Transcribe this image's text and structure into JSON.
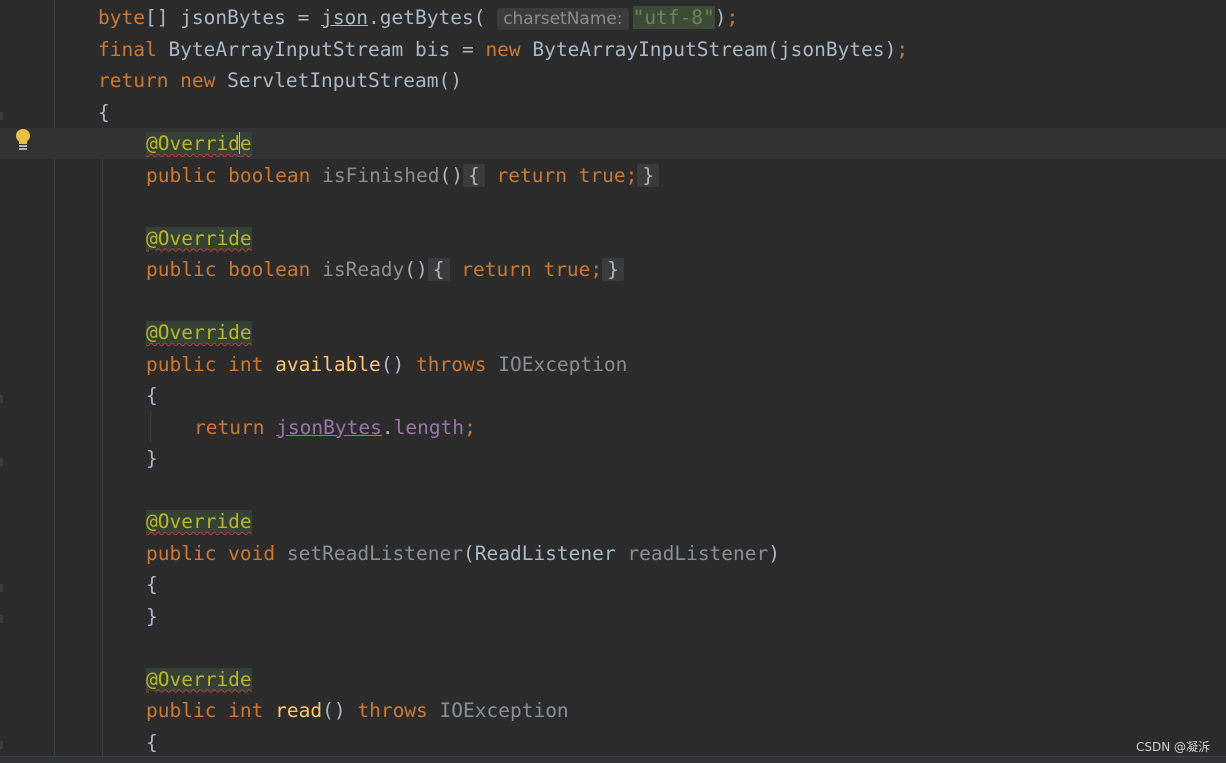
{
  "editor": {
    "lines": [
      {
        "indent": 0,
        "tokens": [
          {
            "t": "byte",
            "c": "kw"
          },
          {
            "t": "[] jsonBytes = "
          },
          {
            "t": "json",
            "c": "ul"
          },
          {
            "t": ".getBytes( "
          },
          {
            "t": "charsetName:",
            "c": "hint"
          },
          {
            "t": "\"utf-8\"",
            "c": "str"
          },
          {
            "t": ")"
          },
          {
            "t": ";",
            "c": "kw"
          }
        ]
      },
      {
        "indent": 0,
        "tokens": [
          {
            "t": "final ",
            "c": "kw"
          },
          {
            "t": "ByteArrayInputStream bis = "
          },
          {
            "t": "new ",
            "c": "kw"
          },
          {
            "t": "ByteArrayInputStream(jsonBytes)"
          },
          {
            "t": ";",
            "c": "kw"
          }
        ]
      },
      {
        "indent": 0,
        "tokens": [
          {
            "t": "return new ",
            "c": "kw"
          },
          {
            "t": "ServletInputStream()"
          }
        ]
      },
      {
        "indent": 0,
        "tokens": [
          {
            "t": "{"
          }
        ]
      },
      {
        "indent": 1,
        "current": true,
        "tokens": [
          {
            "t": "@Overrid",
            "c": "ann"
          },
          {
            "t": "",
            "c": "caret"
          },
          {
            "t": "e",
            "c": "ann"
          }
        ]
      },
      {
        "indent": 1,
        "tokens": [
          {
            "t": "public boolean ",
            "c": "kw"
          },
          {
            "t": "isFinished",
            "c": "mut"
          },
          {
            "t": "()"
          },
          {
            "t": "{",
            "c": "fold-box"
          },
          {
            "t": " return true",
            "c": "kw"
          },
          {
            "t": ";",
            "c": "kw"
          },
          {
            "t": "}",
            "c": "fold-box"
          }
        ]
      },
      {
        "indent": 1,
        "tokens": []
      },
      {
        "indent": 1,
        "tokens": [
          {
            "t": "@Override",
            "c": "ann"
          }
        ]
      },
      {
        "indent": 1,
        "tokens": [
          {
            "t": "public boolean ",
            "c": "kw"
          },
          {
            "t": "isReady",
            "c": "mut"
          },
          {
            "t": "()"
          },
          {
            "t": "{",
            "c": "fold-box"
          },
          {
            "t": " return true",
            "c": "kw"
          },
          {
            "t": ";",
            "c": "kw"
          },
          {
            "t": "}",
            "c": "fold-box"
          }
        ]
      },
      {
        "indent": 1,
        "tokens": []
      },
      {
        "indent": 1,
        "tokens": [
          {
            "t": "@Override",
            "c": "ann"
          }
        ]
      },
      {
        "indent": 1,
        "tokens": [
          {
            "t": "public int ",
            "c": "kw"
          },
          {
            "t": "available",
            "c": "fn"
          },
          {
            "t": "() "
          },
          {
            "t": "throws ",
            "c": "kw"
          },
          {
            "t": "IOException",
            "c": "mut"
          }
        ]
      },
      {
        "indent": 1,
        "tokens": [
          {
            "t": "{"
          }
        ]
      },
      {
        "indent": 2,
        "tokens": [
          {
            "t": "return ",
            "c": "kw"
          },
          {
            "t": "jsonBytes",
            "c": "field"
          },
          {
            "t": "."
          },
          {
            "t": "length",
            "c": "field-plain"
          },
          {
            "t": ";",
            "c": "kw"
          }
        ]
      },
      {
        "indent": 1,
        "tokens": [
          {
            "t": "}"
          }
        ]
      },
      {
        "indent": 1,
        "tokens": []
      },
      {
        "indent": 1,
        "tokens": [
          {
            "t": "@Override",
            "c": "ann"
          }
        ]
      },
      {
        "indent": 1,
        "tokens": [
          {
            "t": "public void ",
            "c": "kw"
          },
          {
            "t": "setReadListener",
            "c": "mut"
          },
          {
            "t": "(ReadListener "
          },
          {
            "t": "readListener",
            "c": "mut"
          },
          {
            "t": ")"
          }
        ]
      },
      {
        "indent": 1,
        "tokens": [
          {
            "t": "{"
          }
        ]
      },
      {
        "indent": 1,
        "tokens": [
          {
            "t": "}"
          }
        ]
      },
      {
        "indent": 1,
        "tokens": []
      },
      {
        "indent": 1,
        "tokens": [
          {
            "t": "@Override",
            "c": "ann"
          }
        ]
      },
      {
        "indent": 1,
        "tokens": [
          {
            "t": "public int ",
            "c": "kw"
          },
          {
            "t": "read",
            "c": "fn"
          },
          {
            "t": "() "
          },
          {
            "t": "throws ",
            "c": "kw"
          },
          {
            "t": "IOException",
            "c": "mut"
          }
        ]
      },
      {
        "indent": 1,
        "tokens": [
          {
            "t": "{"
          }
        ]
      }
    ]
  },
  "icons": {
    "intention": "lightbulb-icon"
  },
  "colors": {
    "background": "#2b2b2b",
    "keyword": "#cc7832",
    "annotation": "#bbb529",
    "string": "#6a8759",
    "method": "#ffc66d",
    "field": "#9876aa"
  },
  "watermark": "CSDN @凝泝"
}
